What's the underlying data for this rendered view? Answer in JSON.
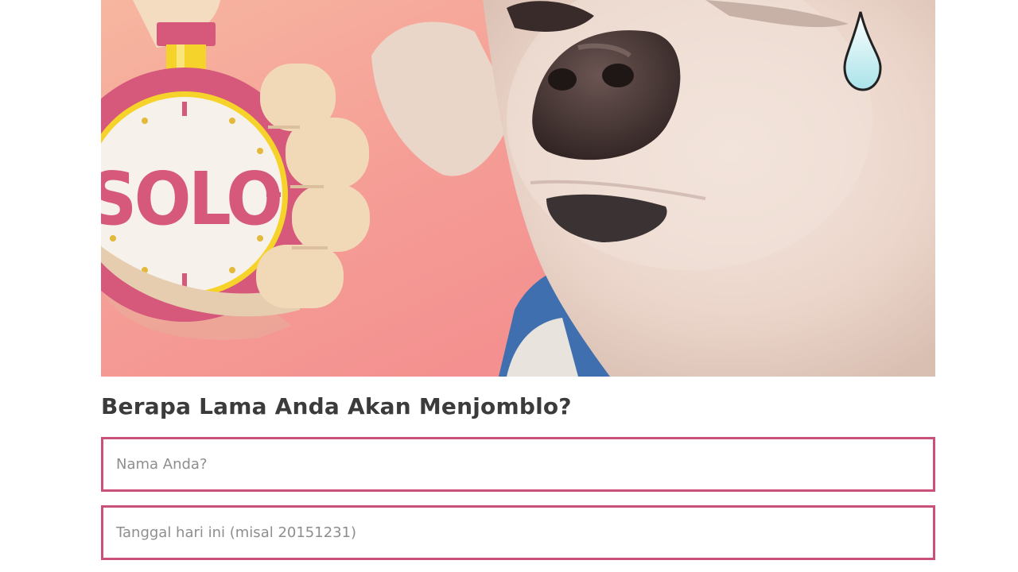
{
  "hero": {
    "badge_text": "SOLO"
  },
  "title": "Berapa Lama Anda Akan Menjomblo?",
  "form": {
    "name_placeholder": "Nama Anda?",
    "name_value": "",
    "date_placeholder": "Tanggal hari ini (misal 20151231)",
    "date_value": ""
  },
  "colors": {
    "accent_border": "#c9517c",
    "title_text": "#3b3b3b",
    "placeholder_text": "#8e8e8e",
    "hero_pink": "#f29490",
    "stopwatch_ring": "#d6587b",
    "stopwatch_yellow": "#f6d32b"
  }
}
